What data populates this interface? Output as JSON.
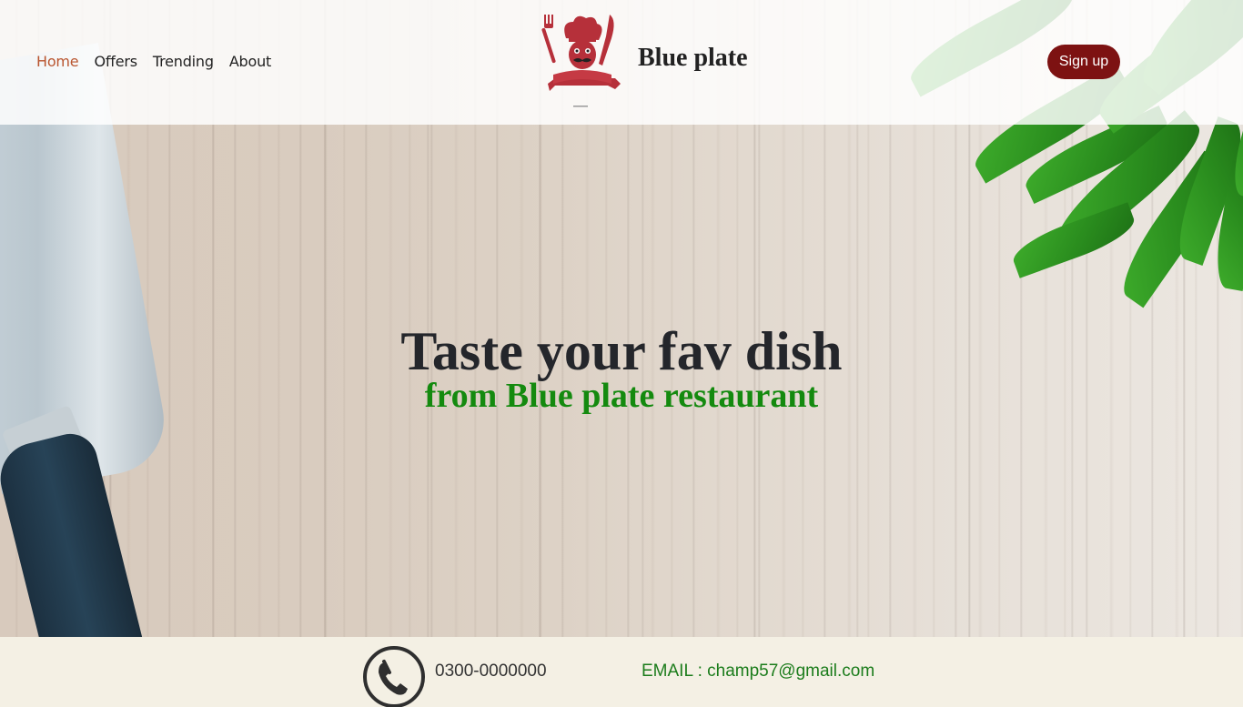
{
  "nav": {
    "items": [
      {
        "label": "Home",
        "active": true
      },
      {
        "label": "Offers",
        "active": false
      },
      {
        "label": "Trending",
        "active": false
      },
      {
        "label": "About",
        "active": false
      }
    ]
  },
  "brand": {
    "name": "Blue plate",
    "logo_icon": "chef-hat-fork-knife-icon"
  },
  "header": {
    "signup_label": "Sign up"
  },
  "hero": {
    "title": "Taste your fav dish",
    "subtitle": "from Blue plate restaurant"
  },
  "footer": {
    "phone_icon": "phone-icon",
    "phone": "0300-0000000",
    "email": "EMAIL : champ57@gmail.com"
  },
  "colors": {
    "accent_active_nav": "#b9552f",
    "signup_button": "#7d1212",
    "subtitle_green": "#148a0f",
    "email_green": "#1b7c1b",
    "footer_bg": "#f4f0e4"
  }
}
